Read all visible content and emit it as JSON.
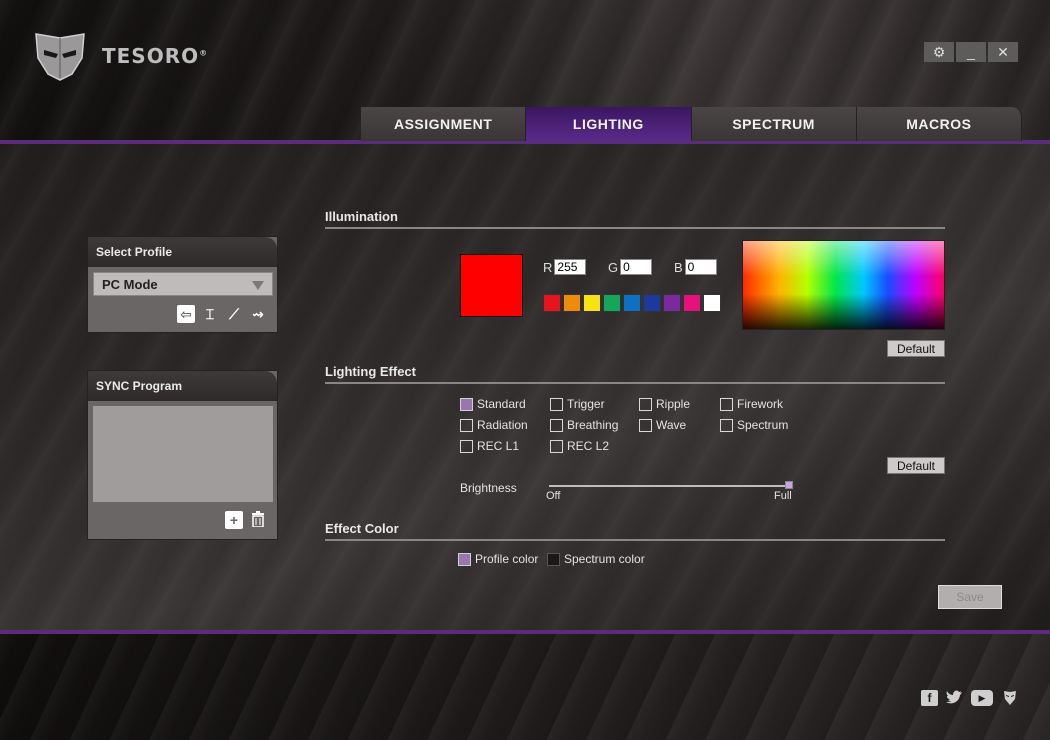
{
  "app": {
    "brand": "TESORO",
    "brand_mark": "®"
  },
  "window_controls": {
    "settings": "⚙",
    "minimize": "_",
    "close": "✕"
  },
  "tabs": [
    {
      "label": "ASSIGNMENT",
      "active": false
    },
    {
      "label": "LIGHTING",
      "active": true
    },
    {
      "label": "SPECTRUM",
      "active": false
    },
    {
      "label": "MACROS",
      "active": false
    }
  ],
  "profile_panel": {
    "title": "Select Profile",
    "selected": "PC Mode",
    "icons": [
      "import-icon",
      "edit-profile-icon",
      "copy-profile-icon",
      "export-profile-icon"
    ]
  },
  "sync_panel": {
    "title": "SYNC Program",
    "icons": [
      "add-icon",
      "trash-icon"
    ]
  },
  "illumination": {
    "title": "Illumination",
    "current_color": "#ff0000",
    "r_label": "R",
    "g_label": "G",
    "b_label": "B",
    "r": "255",
    "g": "0",
    "b": "0",
    "palette": [
      "#e8141d",
      "#f08a0a",
      "#f7e312",
      "#14a65a",
      "#0d70c2",
      "#1d3a9a",
      "#7b2a9e",
      "#e5127e",
      "#ffffff"
    ],
    "default_label": "Default"
  },
  "lighting_effect": {
    "title": "Lighting Effect",
    "effects": [
      {
        "label": "Standard",
        "checked": true
      },
      {
        "label": "Trigger",
        "checked": false
      },
      {
        "label": "Ripple",
        "checked": false
      },
      {
        "label": "Firework",
        "checked": false
      },
      {
        "label": "Radiation",
        "checked": false
      },
      {
        "label": "Breathing",
        "checked": false
      },
      {
        "label": "Wave",
        "checked": false
      },
      {
        "label": "Spectrum",
        "checked": false
      },
      {
        "label": "REC L1",
        "checked": false
      },
      {
        "label": "REC L2",
        "checked": false
      }
    ],
    "default_label": "Default",
    "brightness_label": "Brightness",
    "brightness_min_label": "Off",
    "brightness_max_label": "Full",
    "brightness_level": 1.0
  },
  "effect_color": {
    "title": "Effect Color",
    "profile_color_label": "Profile color",
    "profile_color_checked": true,
    "spectrum_color_label": "Spectrum color",
    "spectrum_color_checked": false
  },
  "save_label": "Save",
  "colors": {
    "accent_purple": "#5a2c7c",
    "active_tab": "#4a1f78"
  },
  "social": [
    "facebook-icon",
    "twitter-icon",
    "youtube-icon",
    "tesoro-icon"
  ]
}
